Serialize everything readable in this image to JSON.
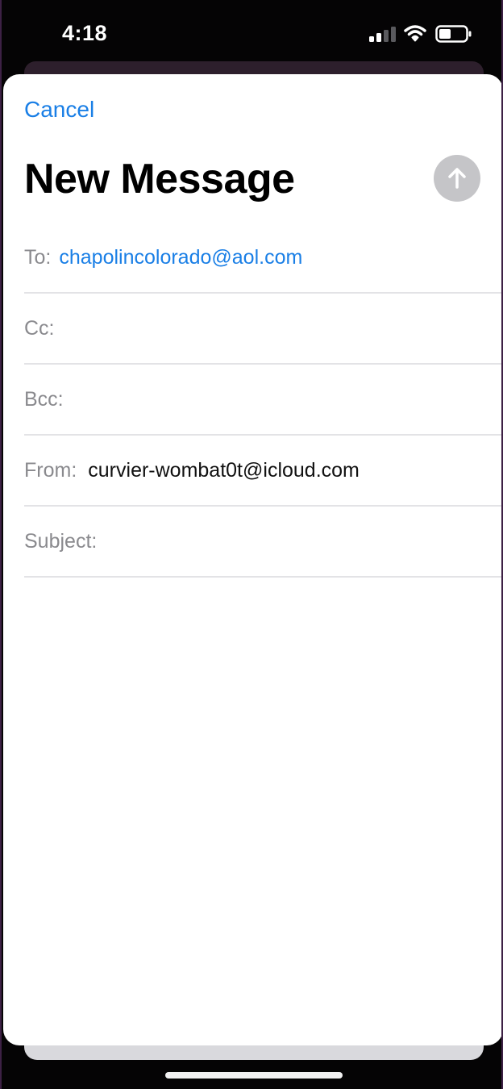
{
  "status_bar": {
    "time": "4:18",
    "icons": [
      "signal-icon",
      "wifi-icon",
      "battery-icon"
    ]
  },
  "compose": {
    "cancel_label": "Cancel",
    "title": "New Message",
    "send_icon": "arrow-up-icon",
    "fields": {
      "to_label": "To:",
      "to_value": "chapolincolorado@aol.com",
      "cc_label": "Cc:",
      "bcc_label": "Bcc:",
      "from_label": "From:",
      "from_value": "curvier-wombat0t@icloud.com",
      "subject_label": "Subject:"
    }
  },
  "colors": {
    "accent": "#1a7fe6",
    "label_gray": "#8a8a8e",
    "send_disabled": "#c5c5c8"
  }
}
